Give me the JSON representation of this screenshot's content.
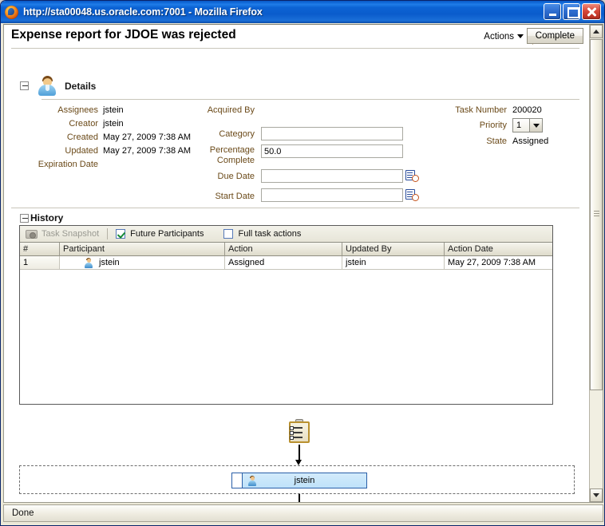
{
  "window": {
    "title": "http://sta00048.us.oracle.com:7001 - Mozilla Firefox",
    "icon": "firefox-icon",
    "minimize_label": "Minimize",
    "maximize_label": "Maximize",
    "close_label": "Close"
  },
  "header": {
    "title": "Expense report for JDOE was rejected",
    "actions_label": "Actions",
    "complete_label": "Complete"
  },
  "details": {
    "section_title": "Details",
    "left": {
      "assignees_label": "Assignees",
      "assignees_value": "jstein",
      "creator_label": "Creator",
      "creator_value": "jstein",
      "created_label": "Created",
      "created_value": "May 27, 2009 7:38 AM",
      "updated_label": "Updated",
      "updated_value": "May 27, 2009 7:38 AM",
      "expiration_label": "Expiration Date",
      "expiration_value": ""
    },
    "middle": {
      "acquired_by_label": "Acquired By",
      "acquired_by_value": "",
      "category_label": "Category",
      "category_value": "",
      "percentage_label": "Percentage Complete",
      "percentage_value": "50.0",
      "due_date_label": "Due Date",
      "due_date_value": "",
      "start_date_label": "Start Date",
      "start_date_value": ""
    },
    "right": {
      "task_number_label": "Task Number",
      "task_number_value": "200020",
      "priority_label": "Priority",
      "priority_value": "1",
      "state_label": "State",
      "state_value": "Assigned"
    }
  },
  "history": {
    "section_title": "History",
    "toolbar": {
      "task_snapshot_label": "Task Snapshot",
      "future_participants_label": "Future Participants",
      "future_participants_checked": true,
      "full_task_actions_label": "Full task actions",
      "full_task_actions_checked": false
    },
    "columns": [
      "#",
      "Participant",
      "Action",
      "Updated By",
      "Action Date"
    ],
    "rows": [
      {
        "index": "1",
        "participant": "jstein",
        "action": "Assigned",
        "updated_by": "jstein",
        "action_date": "May 27, 2009 7:38 AM"
      }
    ]
  },
  "workflow": {
    "start_node": "task-clipboard-icon",
    "participant_node": "jstein",
    "end_node": "task-complete-clipboard-icon"
  },
  "statusbar": {
    "text": "Done"
  }
}
